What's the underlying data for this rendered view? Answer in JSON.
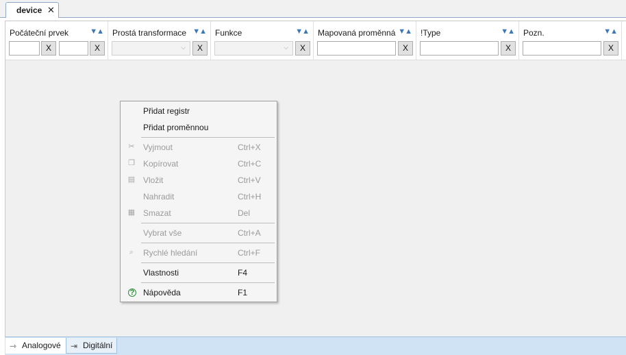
{
  "document_tab": {
    "label": "device",
    "close": "✕"
  },
  "columns": [
    {
      "title": "Počáteční prvek",
      "sort": "▼▲"
    },
    {
      "title": "Prostá transformace",
      "sort": "▼▲"
    },
    {
      "title": "Funkce",
      "sort": "▼▲"
    },
    {
      "title": "Mapovaná proměnná",
      "sort": "▼▲"
    },
    {
      "title": "!Type",
      "sort": "▼▲"
    },
    {
      "title": "Pozn.",
      "sort": "▼▲"
    }
  ],
  "filters": {
    "clear_label": "X",
    "start_from": "",
    "start_to": "",
    "transform_selected": "",
    "function_selected": "",
    "mapped_variable": "",
    "type": "",
    "note": ""
  },
  "context_menu": {
    "items": [
      {
        "label": "Přidat registr",
        "shortcut": "",
        "enabled": true,
        "icon": ""
      },
      {
        "label": "Přidat proměnnou",
        "shortcut": "",
        "enabled": true,
        "icon": ""
      },
      {
        "label": "Vyjmout",
        "shortcut": "Ctrl+X",
        "enabled": false,
        "icon": "scissors-icon"
      },
      {
        "label": "Kopírovat",
        "shortcut": "Ctrl+C",
        "enabled": false,
        "icon": "copy-icon"
      },
      {
        "label": "Vložit",
        "shortcut": "Ctrl+V",
        "enabled": false,
        "icon": "paste-icon"
      },
      {
        "label": "Nahradit",
        "shortcut": "Ctrl+H",
        "enabled": false,
        "icon": ""
      },
      {
        "label": "Smazat",
        "shortcut": "Del",
        "enabled": false,
        "icon": "delete-icon"
      },
      {
        "label": "Vybrat vše",
        "shortcut": "Ctrl+A",
        "enabled": false,
        "icon": ""
      },
      {
        "label": "Rychlé hledání",
        "shortcut": "Ctrl+F",
        "enabled": false,
        "icon": "quick-search-icon"
      },
      {
        "label": "Vlastnosti",
        "shortcut": "F4",
        "enabled": true,
        "icon": ""
      },
      {
        "label": "Nápověda",
        "shortcut": "F1",
        "enabled": true,
        "icon": "help-icon"
      }
    ]
  },
  "bottom_tabs": [
    {
      "label": "Analogové",
      "active": true,
      "icon": "analog-signal-icon"
    },
    {
      "label": "Digitální",
      "active": false,
      "icon": "digital-signal-icon"
    }
  ],
  "colors": {
    "accent": "#3d78b5",
    "bottom_bar": "#cfe3f5",
    "menu_bg": "#f5f5f5",
    "disabled_text": "#9a9a9a"
  }
}
